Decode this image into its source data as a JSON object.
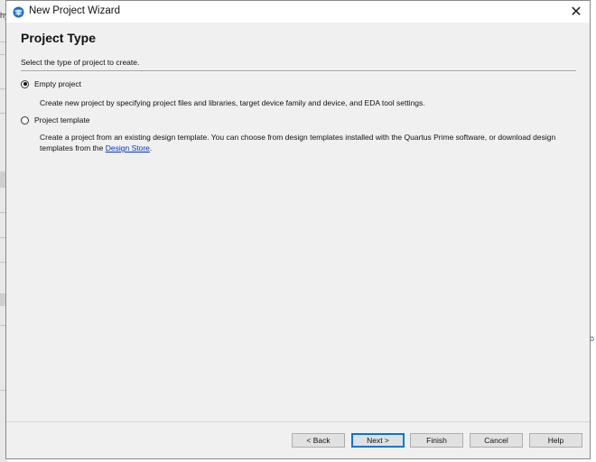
{
  "window": {
    "title": "New Project Wizard",
    "close_symbol": "✕"
  },
  "page": {
    "title": "Project Type",
    "instruction": "Select the type of project to create."
  },
  "options": [
    {
      "label": "Empty project",
      "selected": true,
      "description": "Create new project by specifying project files and libraries, target device family and device, and EDA tool settings."
    },
    {
      "label": "Project template",
      "selected": false,
      "description_prefix": "Create a project from an existing design template. You can choose from design templates installed with the Quartus Prime software, or download design templates from the ",
      "link_text": "Design Store",
      "description_suffix": "."
    }
  ],
  "buttons": {
    "back": "< Back",
    "next": "Next >",
    "finish": "Finish",
    "cancel": "Cancel",
    "help": "Help"
  },
  "background": {
    "left_fragment": "hy",
    "right_fragment": "o"
  },
  "colors": {
    "dialog_bg": "#f0f0f0",
    "link": "#0033cc",
    "default_button_border": "#0078d7",
    "icon_blue": "#1e6fc8"
  },
  "icons": {
    "app": "quartus-globe-icon",
    "close": "close-icon"
  }
}
